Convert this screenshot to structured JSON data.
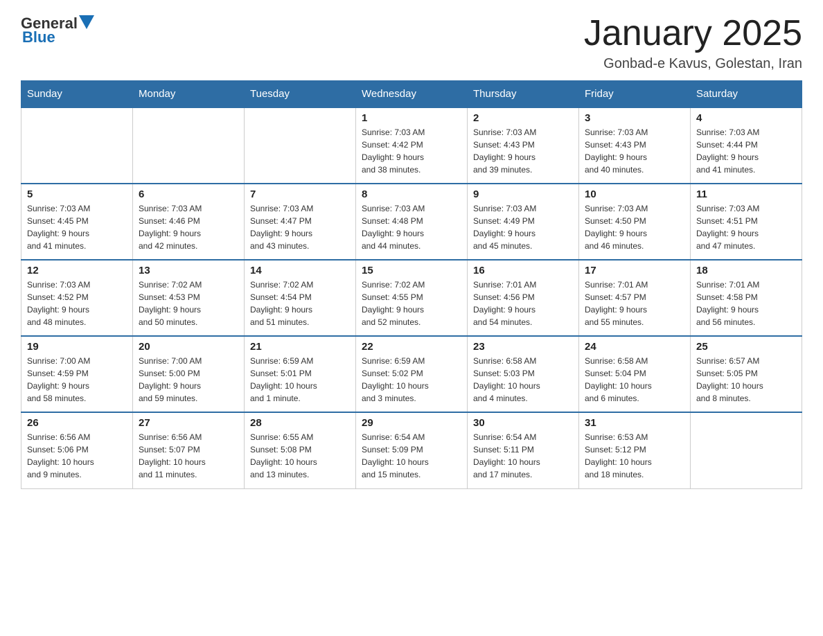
{
  "header": {
    "logo_general": "General",
    "logo_blue": "Blue",
    "month_title": "January 2025",
    "location": "Gonbad-e Kavus, Golestan, Iran"
  },
  "days_of_week": [
    "Sunday",
    "Monday",
    "Tuesday",
    "Wednesday",
    "Thursday",
    "Friday",
    "Saturday"
  ],
  "weeks": [
    [
      {
        "day": "",
        "info": ""
      },
      {
        "day": "",
        "info": ""
      },
      {
        "day": "",
        "info": ""
      },
      {
        "day": "1",
        "info": "Sunrise: 7:03 AM\nSunset: 4:42 PM\nDaylight: 9 hours\nand 38 minutes."
      },
      {
        "day": "2",
        "info": "Sunrise: 7:03 AM\nSunset: 4:43 PM\nDaylight: 9 hours\nand 39 minutes."
      },
      {
        "day": "3",
        "info": "Sunrise: 7:03 AM\nSunset: 4:43 PM\nDaylight: 9 hours\nand 40 minutes."
      },
      {
        "day": "4",
        "info": "Sunrise: 7:03 AM\nSunset: 4:44 PM\nDaylight: 9 hours\nand 41 minutes."
      }
    ],
    [
      {
        "day": "5",
        "info": "Sunrise: 7:03 AM\nSunset: 4:45 PM\nDaylight: 9 hours\nand 41 minutes."
      },
      {
        "day": "6",
        "info": "Sunrise: 7:03 AM\nSunset: 4:46 PM\nDaylight: 9 hours\nand 42 minutes."
      },
      {
        "day": "7",
        "info": "Sunrise: 7:03 AM\nSunset: 4:47 PM\nDaylight: 9 hours\nand 43 minutes."
      },
      {
        "day": "8",
        "info": "Sunrise: 7:03 AM\nSunset: 4:48 PM\nDaylight: 9 hours\nand 44 minutes."
      },
      {
        "day": "9",
        "info": "Sunrise: 7:03 AM\nSunset: 4:49 PM\nDaylight: 9 hours\nand 45 minutes."
      },
      {
        "day": "10",
        "info": "Sunrise: 7:03 AM\nSunset: 4:50 PM\nDaylight: 9 hours\nand 46 minutes."
      },
      {
        "day": "11",
        "info": "Sunrise: 7:03 AM\nSunset: 4:51 PM\nDaylight: 9 hours\nand 47 minutes."
      }
    ],
    [
      {
        "day": "12",
        "info": "Sunrise: 7:03 AM\nSunset: 4:52 PM\nDaylight: 9 hours\nand 48 minutes."
      },
      {
        "day": "13",
        "info": "Sunrise: 7:02 AM\nSunset: 4:53 PM\nDaylight: 9 hours\nand 50 minutes."
      },
      {
        "day": "14",
        "info": "Sunrise: 7:02 AM\nSunset: 4:54 PM\nDaylight: 9 hours\nand 51 minutes."
      },
      {
        "day": "15",
        "info": "Sunrise: 7:02 AM\nSunset: 4:55 PM\nDaylight: 9 hours\nand 52 minutes."
      },
      {
        "day": "16",
        "info": "Sunrise: 7:01 AM\nSunset: 4:56 PM\nDaylight: 9 hours\nand 54 minutes."
      },
      {
        "day": "17",
        "info": "Sunrise: 7:01 AM\nSunset: 4:57 PM\nDaylight: 9 hours\nand 55 minutes."
      },
      {
        "day": "18",
        "info": "Sunrise: 7:01 AM\nSunset: 4:58 PM\nDaylight: 9 hours\nand 56 minutes."
      }
    ],
    [
      {
        "day": "19",
        "info": "Sunrise: 7:00 AM\nSunset: 4:59 PM\nDaylight: 9 hours\nand 58 minutes."
      },
      {
        "day": "20",
        "info": "Sunrise: 7:00 AM\nSunset: 5:00 PM\nDaylight: 9 hours\nand 59 minutes."
      },
      {
        "day": "21",
        "info": "Sunrise: 6:59 AM\nSunset: 5:01 PM\nDaylight: 10 hours\nand 1 minute."
      },
      {
        "day": "22",
        "info": "Sunrise: 6:59 AM\nSunset: 5:02 PM\nDaylight: 10 hours\nand 3 minutes."
      },
      {
        "day": "23",
        "info": "Sunrise: 6:58 AM\nSunset: 5:03 PM\nDaylight: 10 hours\nand 4 minutes."
      },
      {
        "day": "24",
        "info": "Sunrise: 6:58 AM\nSunset: 5:04 PM\nDaylight: 10 hours\nand 6 minutes."
      },
      {
        "day": "25",
        "info": "Sunrise: 6:57 AM\nSunset: 5:05 PM\nDaylight: 10 hours\nand 8 minutes."
      }
    ],
    [
      {
        "day": "26",
        "info": "Sunrise: 6:56 AM\nSunset: 5:06 PM\nDaylight: 10 hours\nand 9 minutes."
      },
      {
        "day": "27",
        "info": "Sunrise: 6:56 AM\nSunset: 5:07 PM\nDaylight: 10 hours\nand 11 minutes."
      },
      {
        "day": "28",
        "info": "Sunrise: 6:55 AM\nSunset: 5:08 PM\nDaylight: 10 hours\nand 13 minutes."
      },
      {
        "day": "29",
        "info": "Sunrise: 6:54 AM\nSunset: 5:09 PM\nDaylight: 10 hours\nand 15 minutes."
      },
      {
        "day": "30",
        "info": "Sunrise: 6:54 AM\nSunset: 5:11 PM\nDaylight: 10 hours\nand 17 minutes."
      },
      {
        "day": "31",
        "info": "Sunrise: 6:53 AM\nSunset: 5:12 PM\nDaylight: 10 hours\nand 18 minutes."
      },
      {
        "day": "",
        "info": ""
      }
    ]
  ]
}
